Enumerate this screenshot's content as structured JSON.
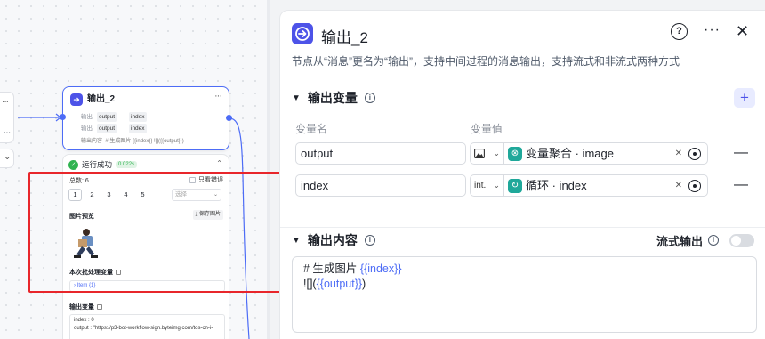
{
  "canvas": {
    "node": {
      "title": "输出_2",
      "rows": [
        {
          "label": "输出",
          "tag1": "output",
          "tag2": "index"
        },
        {
          "label": "输出",
          "tag1": "output",
          "tag2": "index"
        }
      ],
      "content_label": "输出内容",
      "content_value": "# 生成图片 {{index}} ![]({{output}})"
    },
    "run": {
      "status": "运行成功",
      "time": "0.022s",
      "total": "总数: 6",
      "only_errors": "只看错误",
      "pages": [
        "1",
        "2",
        "3",
        "4",
        "5"
      ],
      "select_placeholder": "选择",
      "image_preview": "图片预览",
      "save_image": "保存图片",
      "batch_vars": "本次批处理变量",
      "batch_value": "Item {1}",
      "output_vars": "输出变量",
      "out_index": "index : 0",
      "out_output": "output : \"https://p3-bot-workflow-sign.byteimg.com/tos-cn-i-"
    }
  },
  "panel": {
    "title": "输出_2",
    "description": "节点从“消息”更名为“输出”，支持中间过程的消息输出，支持流式和非流式两种方式",
    "output_vars": {
      "heading": "输出变量",
      "col_name": "变量名",
      "col_value": "变量值",
      "rows": [
        {
          "name": "output",
          "type": "",
          "ref": "变量聚合 · image"
        },
        {
          "name": "index",
          "type": "int.",
          "ref": "循环 · index"
        }
      ]
    },
    "output_content": {
      "heading": "输出内容",
      "stream_label": "流式输出",
      "line1_prefix": "# 生成图片 ",
      "line1_tpl": "{{index}}",
      "line2_prefix": "![](",
      "line2_tpl": "{{output}}",
      "line2_suffix": ")"
    }
  },
  "colors": {
    "accent": "#4d53e8",
    "highlight": "#e8262b",
    "success": "#2fb350",
    "ref_icon": "#1fa89a"
  }
}
